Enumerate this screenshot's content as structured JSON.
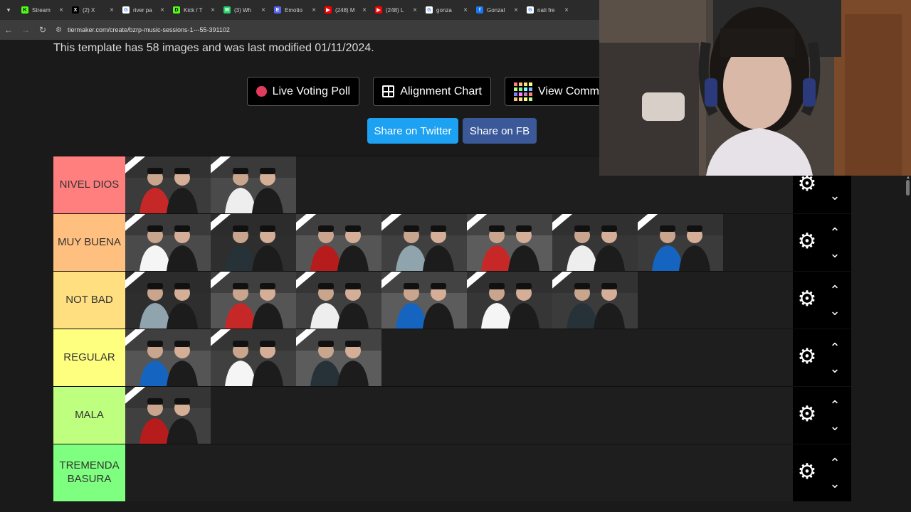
{
  "browser": {
    "tabs": [
      {
        "label": "Stream",
        "icon": "kick-icon",
        "fav_color": "#53fc18",
        "fav_glyph": "K"
      },
      {
        "label": "(2) X",
        "icon": "x-icon",
        "fav_color": "#000000",
        "fav_glyph": "X"
      },
      {
        "label": "river pa",
        "icon": "google-icon",
        "fav_color": "#ffffff",
        "fav_glyph": "G"
      },
      {
        "label": "Kick / T",
        "icon": "kick-icon",
        "fav_color": "#53fc18",
        "fav_glyph": "D"
      },
      {
        "label": "(3) Wh",
        "icon": "whatsapp-icon",
        "fav_color": "#25d366",
        "fav_glyph": "W"
      },
      {
        "label": "Emotio",
        "icon": "emotion-icon",
        "fav_color": "#5865f2",
        "fav_glyph": "E"
      },
      {
        "label": "(248) M",
        "icon": "youtube-icon",
        "fav_color": "#ff0000",
        "fav_glyph": "▶"
      },
      {
        "label": "(248) L",
        "icon": "youtube-icon",
        "fav_color": "#ff0000",
        "fav_glyph": "▶"
      },
      {
        "label": "gonza",
        "icon": "google-icon",
        "fav_color": "#ffffff",
        "fav_glyph": "G"
      },
      {
        "label": "Gonzal",
        "icon": "facebook-icon",
        "fav_color": "#1877f2",
        "fav_glyph": "f"
      },
      {
        "label": "nati fre",
        "icon": "google-icon",
        "fav_color": "#ffffff",
        "fav_glyph": "G"
      }
    ],
    "url": "tiermaker.com/create/bzrp-music-sessions-1---55-391102"
  },
  "page": {
    "info_text": "This template has 58 images and was last modified 01/11/2024.",
    "buttons": {
      "live_poll": "Live Voting Poll",
      "alignment": "Alignment Chart",
      "view_community": "View Commu"
    },
    "share": {
      "twitter": "Share on Twitter",
      "fb": "Share on FB"
    },
    "colors": {
      "twitter": "#1da1f2",
      "fb": "#3b5998"
    }
  },
  "tiers": [
    {
      "label": "NIVEL DIOS",
      "color": "#ff7f7f",
      "items": 2
    },
    {
      "label": "MUY BUENA",
      "color": "#ffbf7f",
      "items": 7
    },
    {
      "label": "NOT BAD",
      "color": "#ffdf7f",
      "items": 6
    },
    {
      "label": "REGULAR",
      "color": "#ffff7f",
      "items": 3
    },
    {
      "label": "MALA",
      "color": "#bfff7f",
      "items": 1
    },
    {
      "label": "TREMENDA BASURA",
      "color": "#7fff7f",
      "items": 0
    }
  ]
}
